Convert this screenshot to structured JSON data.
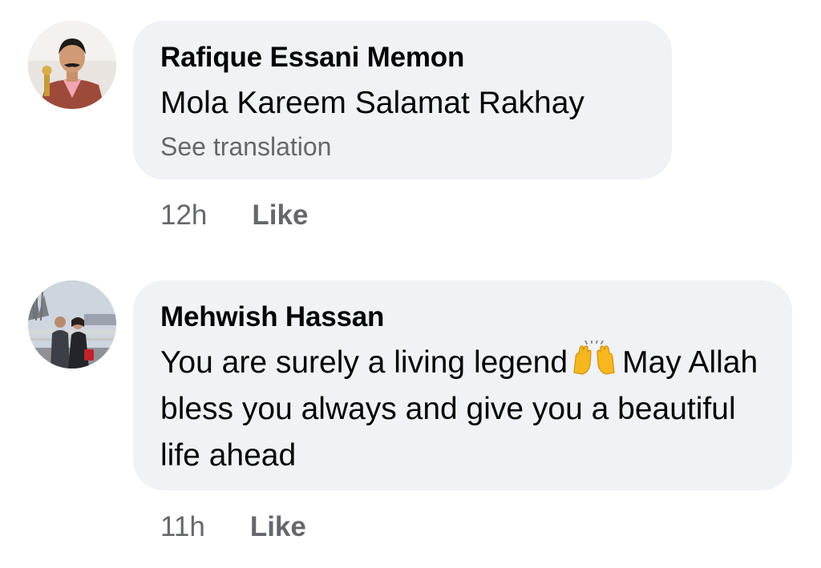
{
  "comments": [
    {
      "author": "Rafique Essani Memon",
      "text": "Mola Kareem Salamat Rakhay",
      "see_translation": "See translation",
      "time": "12h",
      "like_label": "Like",
      "avatar_icon": "profile-photo-man-red-blazer"
    },
    {
      "author": "Mehwish Hassan",
      "text_part1": "You are surely a living legend",
      "emoji_icon": "raising-hands-emoji",
      "text_part2": "May Allah bless you always and give you a beautiful life ahead",
      "time": "11h",
      "like_label": "Like",
      "avatar_icon": "profile-photo-couple-outdoors"
    }
  ],
  "colors": {
    "bubble_bg": "#f0f2f5",
    "secondary_text": "#65676b",
    "primary_text": "#050505"
  }
}
